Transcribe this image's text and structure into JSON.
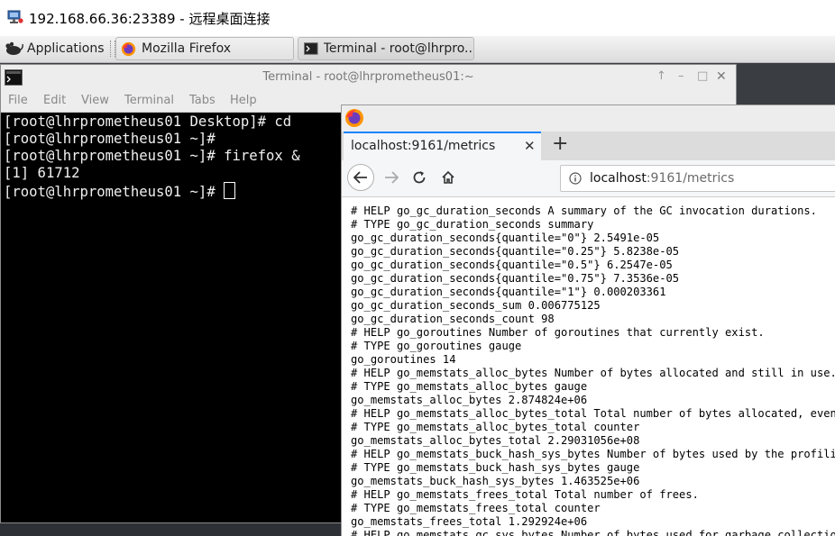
{
  "rdp": {
    "title": "192.168.66.36:23389 - 远程桌面连接",
    "icon": "remote-desktop-icon"
  },
  "panel": {
    "applications_label": "Applications",
    "tasks": [
      {
        "label": "Mozilla Firefox",
        "icon": "firefox-icon"
      },
      {
        "label": "Terminal - root@lhrpro...",
        "icon": "terminal-icon"
      }
    ]
  },
  "terminal": {
    "title": "Terminal - root@lhrprometheus01:~",
    "controls": {
      "up": "↑",
      "minimize": "–",
      "maximize": "□",
      "close": "✕"
    },
    "menu": [
      "File",
      "Edit",
      "View",
      "Terminal",
      "Tabs",
      "Help"
    ],
    "lines": [
      "[root@lhrprometheus01 Desktop]# cd",
      "[root@lhrprometheus01 ~]#",
      "[root@lhrprometheus01 ~]# firefox &",
      "[1] 61712"
    ],
    "prompt": "[root@lhrprometheus01 ~]# "
  },
  "firefox": {
    "tab_title": "localhost:9161/metrics",
    "tab_close": "✕",
    "new_tab": "+",
    "url_host": "localhost",
    "url_path": ":9161/metrics",
    "content_lines": [
      "# HELP go_gc_duration_seconds A summary of the GC invocation durations.",
      "# TYPE go_gc_duration_seconds summary",
      "go_gc_duration_seconds{quantile=\"0\"} 2.5491e-05",
      "go_gc_duration_seconds{quantile=\"0.25\"} 5.8238e-05",
      "go_gc_duration_seconds{quantile=\"0.5\"} 6.2547e-05",
      "go_gc_duration_seconds{quantile=\"0.75\"} 7.3536e-05",
      "go_gc_duration_seconds{quantile=\"1\"} 0.000203361",
      "go_gc_duration_seconds_sum 0.006775125",
      "go_gc_duration_seconds_count 98",
      "# HELP go_goroutines Number of goroutines that currently exist.",
      "# TYPE go_goroutines gauge",
      "go_goroutines 14",
      "# HELP go_memstats_alloc_bytes Number of bytes allocated and still in use.",
      "# TYPE go_memstats_alloc_bytes gauge",
      "go_memstats_alloc_bytes 2.874824e+06",
      "# HELP go_memstats_alloc_bytes_total Total number of bytes allocated, even if",
      "# TYPE go_memstats_alloc_bytes_total counter",
      "go_memstats_alloc_bytes_total 2.29031056e+08",
      "# HELP go_memstats_buck_hash_sys_bytes Number of bytes used by the profiling",
      "# TYPE go_memstats_buck_hash_sys_bytes gauge",
      "go_memstats_buck_hash_sys_bytes 1.463525e+06",
      "# HELP go_memstats_frees_total Total number of frees.",
      "# TYPE go_memstats_frees_total counter",
      "go_memstats_frees_total 1.292924e+06",
      "# HELP go_memstats_gc_sys_bytes Number of bytes used for garbage collection s"
    ]
  },
  "colors": {
    "firefox_accent": "#0a84ff",
    "terminal_bg": "#000000",
    "terminal_fg": "#f0f0f0"
  }
}
